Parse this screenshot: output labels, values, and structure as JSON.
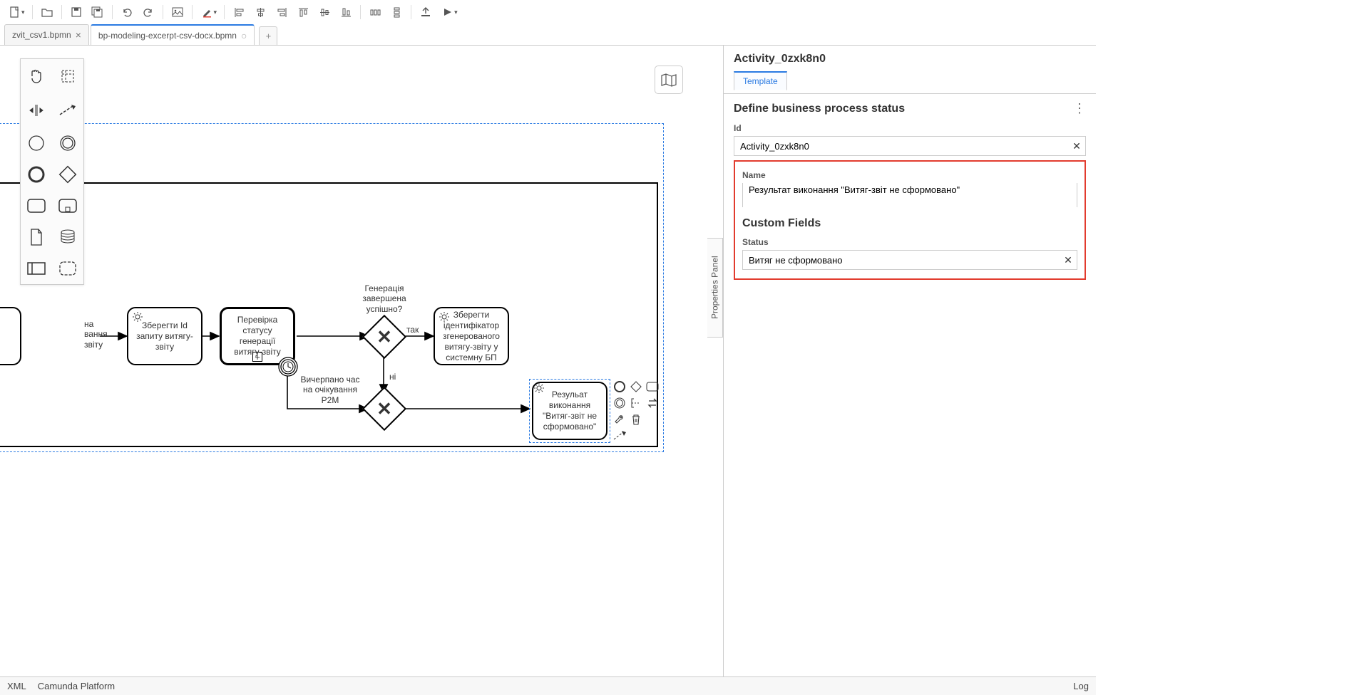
{
  "toolbar": {
    "new": "New",
    "open": "Open",
    "save": "Save",
    "saveAll": "Save all",
    "undo": "Undo",
    "redo": "Redo",
    "image": "Image",
    "color": "Color"
  },
  "tabs": [
    {
      "label": "zvit_csv1.bpmn",
      "active": false,
      "close": "×"
    },
    {
      "label": "bp-modeling-excerpt-csv-docx.bpmn",
      "active": true,
      "dirty": "○"
    }
  ],
  "palette": {
    "hand": "hand",
    "lasso": "lasso",
    "space": "space",
    "connect": "connect",
    "start": "start-event",
    "intermediate": "intermediate-event",
    "end": "end-event",
    "gateway": "gateway",
    "task": "task",
    "callactivity": "call-activity",
    "dataobject": "data-object",
    "datastore": "data-store",
    "participant": "participant",
    "group": "group"
  },
  "diagram": {
    "task_left": "на вання звіту",
    "task_saveid": "Зберегти Id запиту витягу-звіту",
    "task_check": "Перевірка статусу генерації витягу-звіту",
    "gw_top_label": "Генерація завершена успішно?",
    "gw_yes": "так",
    "gw_no": "ні",
    "task_store": "Зберегти ідентифікатор згенерованого витягу-звіту у системну БП",
    "timer_label": "Вичерпано час на очікування P2M",
    "task_result": "Резульат виконання \"Витяг-звіт не сформовано\""
  },
  "props": {
    "toggle": "Properties Panel",
    "title": "Activity_0zxk8n0",
    "tab": "Template",
    "section1": "Define business process status",
    "id_label": "Id",
    "id_value": "Activity_0zxk8n0",
    "name_label": "Name",
    "name_value": "Результат виконання \"Витяг-звіт не сформовано\"",
    "section2": "Custom Fields",
    "status_label": "Status",
    "status_value": "Витяг не сформовано"
  },
  "status": {
    "xml": "XML",
    "platform": "Camunda Platform",
    "log": "Log"
  }
}
